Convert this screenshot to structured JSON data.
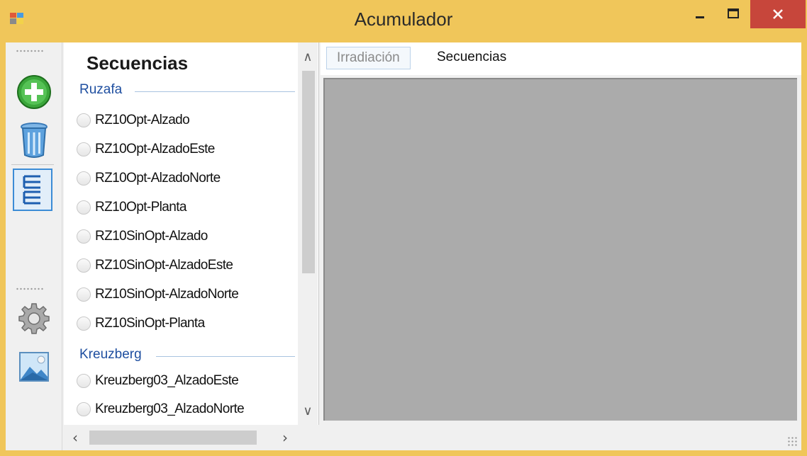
{
  "window": {
    "title": "Acumulador",
    "accent": "#f0c65a",
    "close_color": "#c7463b"
  },
  "toolbar": {
    "buttons": [
      {
        "icon": "add-icon",
        "active": false
      },
      {
        "icon": "trash-icon",
        "active": false
      },
      {
        "icon": "tree-view-icon",
        "active": true
      },
      {
        "icon": "gear-icon",
        "active": false
      },
      {
        "icon": "image-icon",
        "active": false
      }
    ]
  },
  "panel": {
    "title": "Secuencias",
    "groups": [
      {
        "name": "Ruzafa",
        "items": [
          "RZ10Opt-Alzado",
          "RZ10Opt-AlzadoEste",
          "RZ10Opt-AlzadoNorte",
          "RZ10Opt-Planta",
          "RZ10SinOpt-Alzado",
          "RZ10SinOpt-AlzadoEste",
          "RZ10SinOpt-AlzadoNorte",
          "RZ10SinOpt-Planta"
        ]
      },
      {
        "name": "Kreuzberg",
        "items": [
          "Kreuzberg03_AlzadoEste",
          "Kreuzberg03_AlzadoNorte"
        ]
      }
    ]
  },
  "tabs": {
    "irradiacion": "Irradiación",
    "secuencias": "Secuencias"
  }
}
